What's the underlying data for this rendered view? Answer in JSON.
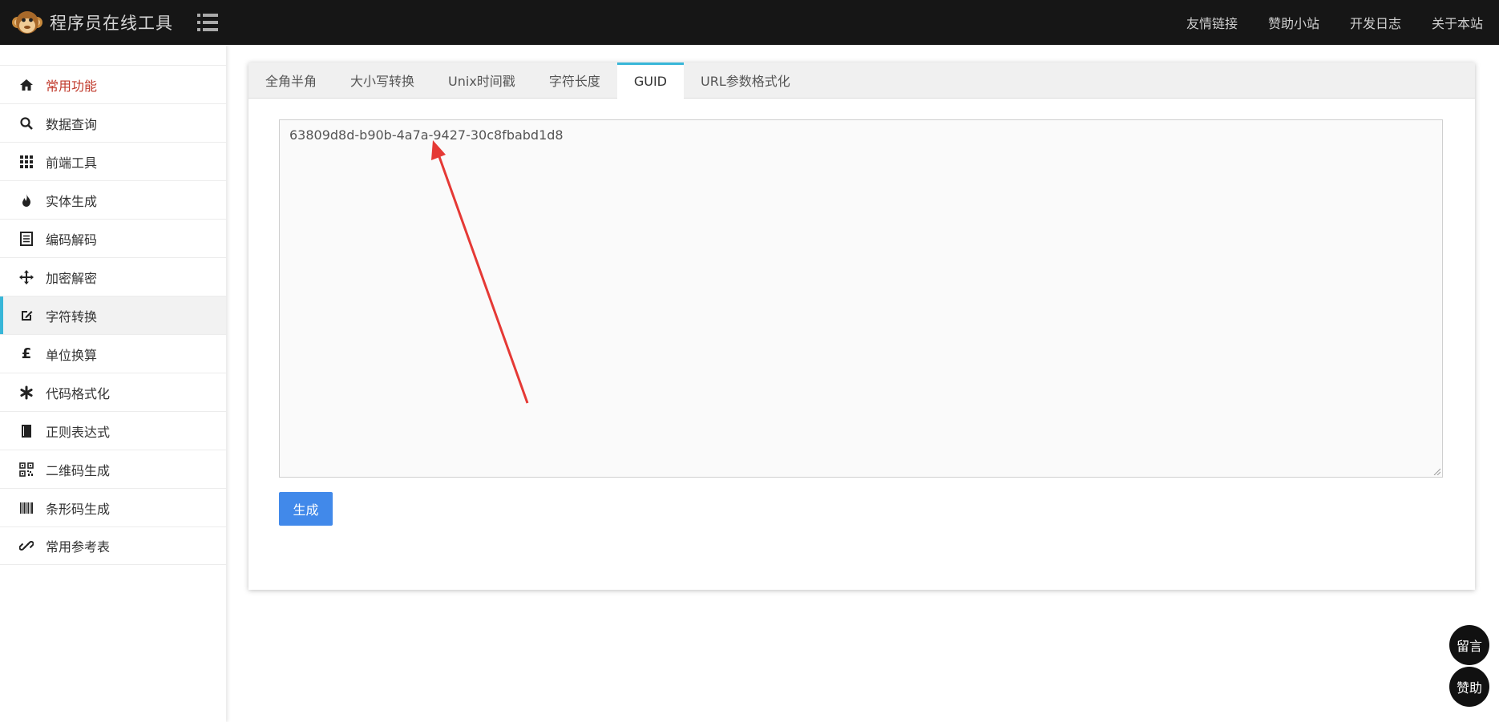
{
  "header": {
    "title": "程序员在线工具",
    "nav": [
      "友情链接",
      "赞助小站",
      "开发日志",
      "关于本站"
    ]
  },
  "sidebar": {
    "items": [
      {
        "label": "常用功能",
        "icon": "home-icon"
      },
      {
        "label": "数据查询",
        "icon": "search-icon"
      },
      {
        "label": "前端工具",
        "icon": "grid-icon"
      },
      {
        "label": "实体生成",
        "icon": "fire-icon"
      },
      {
        "label": "编码解码",
        "icon": "list-icon"
      },
      {
        "label": "加密解密",
        "icon": "move-icon"
      },
      {
        "label": "字符转换",
        "icon": "edit-icon"
      },
      {
        "label": "单位换算",
        "icon": "pound-icon"
      },
      {
        "label": "代码格式化",
        "icon": "asterisk-icon"
      },
      {
        "label": "正则表达式",
        "icon": "book-icon"
      },
      {
        "label": "二维码生成",
        "icon": "qrcode-icon"
      },
      {
        "label": "条形码生成",
        "icon": "barcode-icon"
      },
      {
        "label": "常用参考表",
        "icon": "link-icon"
      }
    ],
    "active_index": 6
  },
  "tabs": [
    {
      "label": "全角半角"
    },
    {
      "label": "大小写转换"
    },
    {
      "label": "Unix时间戳"
    },
    {
      "label": "字符长度"
    },
    {
      "label": "GUID"
    },
    {
      "label": "URL参数格式化"
    }
  ],
  "active_tab": 4,
  "guid_output": "63809d8d-b90b-4a7a-9427-30c8fbabd1d8",
  "generate_button": "生成",
  "float_buttons": {
    "message": "留言",
    "donate": "赞助"
  },
  "colors": {
    "topbar": "#161616",
    "accent": "#38b6d8",
    "button": "#4189ea",
    "active_menu_text": "#c0392b",
    "annotation_arrow": "#e53935"
  }
}
